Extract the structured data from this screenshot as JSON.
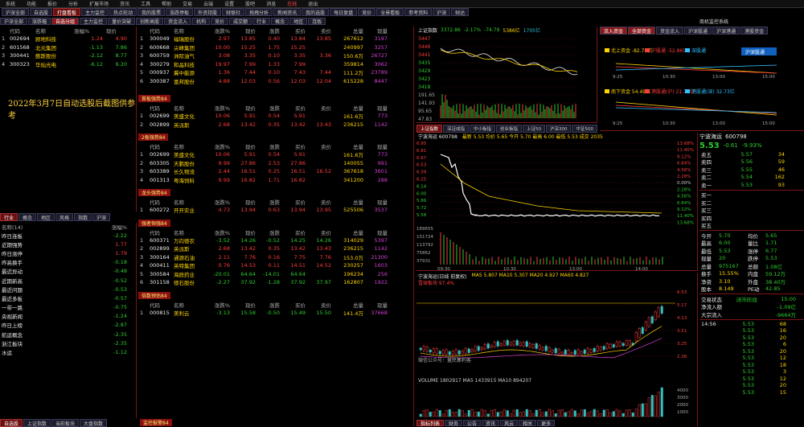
{
  "menu": [
    "系统",
    "功能",
    "报价",
    "分析",
    "扩展市场",
    "资讯",
    "工具",
    "帮助",
    "交易",
    "云端",
    "设置",
    "股吧",
    "消息",
    "在线",
    "退出"
  ],
  "tabs": [
    {
      "label": "沪深全部",
      "active": false
    },
    {
      "label": "自选股",
      "active": false
    },
    {
      "label": "打盘看板",
      "active": true
    },
    {
      "label": "主力监控",
      "active": false
    },
    {
      "label": "热点轮动",
      "active": false
    },
    {
      "label": "我的股票",
      "active": false
    },
    {
      "label": "涨跌停板",
      "active": false
    },
    {
      "label": "外资持股",
      "active": false
    },
    {
      "label": "财联社",
      "active": false
    },
    {
      "label": "拖拽分析",
      "active": false
    },
    {
      "label": "新闻资讯",
      "active": false
    },
    {
      "label": "我的选股",
      "active": false
    },
    {
      "label": "每日复盘",
      "active": false
    },
    {
      "label": "竞价",
      "active": false
    },
    {
      "label": "全景看板",
      "active": false
    },
    {
      "label": "参考资料",
      "active": false
    },
    {
      "label": "沪深",
      "active": false
    },
    {
      "label": "财达",
      "active": false
    }
  ],
  "subtabs": [
    "沪深全部",
    "涨跌幅",
    "自选分组",
    "主力监控",
    "量价突破",
    "创新高股",
    "资金流入",
    "机构",
    "竞价",
    "成交额",
    "行业",
    "概念",
    "地区",
    "连板"
  ],
  "top_right_tab": "商机监控系统",
  "left_table": {
    "headers": [
      "",
      "代码",
      "名称",
      "涨幅%",
      "现价"
    ],
    "rows": [
      [
        "1",
        "002694",
        "顾地科技",
        "1.24",
        "4.90"
      ],
      [
        "2",
        "601568",
        "北元集团",
        "-1.13",
        "7.86"
      ],
      [
        "3",
        "300441",
        "鲍斯股份",
        "-2.12",
        "8.77"
      ],
      [
        "4",
        "300323",
        "华灿光电",
        "-6.12",
        "9.20"
      ]
    ]
  },
  "note": "2022年3月7日自动选股后截图供参考",
  "sector_tabs": [
    "行业",
    "概念",
    "地区",
    "风格",
    "指数",
    "沪深"
  ],
  "sector_table": {
    "headers": [
      "名称(14)",
      "涨幅%"
    ],
    "rows": [
      [
        "昨日连板",
        "-2.22"
      ],
      [
        "近期强势",
        "1.77"
      ],
      [
        "昨日涨停",
        "1.79"
      ],
      [
        "昨高换手",
        "-0.18"
      ],
      [
        "最近异动",
        "-0.48"
      ],
      [
        "近期新高",
        "-0.52"
      ],
      [
        "最近问题",
        "-0.53"
      ],
      [
        "最近多板",
        "-0.57"
      ],
      [
        "一带一路",
        "-0.75"
      ],
      [
        "央视新闻",
        "-1.24"
      ],
      [
        "昨日上榜",
        "-2.87"
      ],
      [
        "航运概念",
        "-2.35"
      ],
      [
        "浙江板块",
        "-2.35"
      ],
      [
        "水运",
        "-1.12"
      ]
    ]
  },
  "bottom_tabs": [
    "自选股",
    "上证指数",
    "当前板块",
    "大盘指数"
  ],
  "mid_headers": [
    "",
    "代码",
    "名称",
    "涨跌%",
    "现价",
    "涨跌",
    "买价",
    "卖价",
    "总量",
    "现量"
  ],
  "mid_groups": [
    {
      "label": "",
      "rows": [
        [
          "1",
          "300049",
          "福瑞股份",
          "2.97",
          "13.85",
          "0.40",
          "13.84",
          "13.85",
          "267612",
          "3197"
        ],
        [
          "2",
          "600668",
          "尖峰集团",
          "10.00",
          "15.25",
          "1.75",
          "15.25",
          "",
          "240997",
          "3257"
        ],
        [
          "3",
          "600759",
          "洲际油气",
          "3.08",
          "3.35",
          "0.10",
          "3.35",
          "3.36",
          "150.6万",
          "26727"
        ],
        [
          "4",
          "300279",
          "和晶科技",
          "19.97",
          "7.99",
          "1.33",
          "7.99",
          "",
          "359814",
          "3062"
        ],
        [
          "5",
          "000937",
          "冀中能源",
          "1.36",
          "7.44",
          "0.10",
          "7.43",
          "7.44",
          "111.2万",
          "23789"
        ],
        [
          "6",
          "300387",
          "富邦股份",
          "4.88",
          "12.03",
          "0.56",
          "12.03",
          "12.04",
          "615228",
          "8447"
        ]
      ]
    },
    {
      "label": "首板强势84",
      "rows": [
        [
          "1",
          "002699",
          "美盛文化",
          "10.06",
          "5.91",
          "0.54",
          "5.91",
          "",
          "161.6万",
          "773"
        ],
        [
          "2",
          "002899",
          "英派斯",
          "2.68",
          "13.42",
          "0.35",
          "13.42",
          "13.43",
          "236215",
          "1142"
        ]
      ]
    },
    {
      "label": "2板强势84",
      "rows": [
        [
          "1",
          "002699",
          "美盛文化",
          "10.06",
          "5.91",
          "0.54",
          "5.91",
          "",
          "161.6万",
          "773"
        ],
        [
          "2",
          "603305",
          "天鹏股份",
          "9.99",
          "27.86",
          "2.53",
          "27.86",
          "",
          "140055",
          "991"
        ],
        [
          "3",
          "603389",
          "长久物流",
          "2.44",
          "16.51",
          "0.25",
          "16.51",
          "16.52",
          "367618",
          "3601"
        ],
        [
          "4",
          "001313",
          "粤海饲料",
          "9.99",
          "16.82",
          "1.71",
          "16.82",
          "",
          "341200",
          "288"
        ]
      ]
    },
    {
      "label": "龙头强势84",
      "rows": [
        [
          "1",
          "600272",
          "开开实业",
          "4.73",
          "13.94",
          "0.63",
          "13.94",
          "13.95",
          "525506",
          "3537"
        ]
      ]
    },
    {
      "label": "强者恒强84",
      "rows": [
        [
          "1",
          "600371",
          "万向德农",
          "-3.52",
          "14.26",
          "-0.52",
          "14.25",
          "14.26",
          "314029",
          "5397"
        ],
        [
          "2",
          "002899",
          "英派斯",
          "2.68",
          "13.42",
          "0.35",
          "13.42",
          "13.43",
          "236215",
          "1142"
        ],
        [
          "3",
          "300164",
          "通源石油",
          "2.11",
          "7.76",
          "0.16",
          "7.75",
          "7.76",
          "153.0万",
          "21300"
        ],
        [
          "4",
          "000411",
          "英特集团",
          "0.76",
          "14.53",
          "0.11",
          "14.51",
          "14.52",
          "230257",
          "1603"
        ],
        [
          "5",
          "300584",
          "海辰药业",
          "-20.01",
          "64.64",
          "-14.01",
          "64.64",
          "",
          "196234",
          "256"
        ],
        [
          "6",
          "301158",
          "德石股份",
          "-2.27",
          "37.92",
          "-1.28",
          "37.92",
          "37.97",
          "162807",
          "1922"
        ]
      ]
    },
    {
      "label": "倍数预估84",
      "rows": [
        [
          "1",
          "000815",
          "美利云",
          "-3.13",
          "15.58",
          "-0.50",
          "15.49",
          "15.50",
          "141.4万",
          "37668"
        ]
      ]
    }
  ],
  "mid_bottom_label": "监控报警84",
  "index_panel": {
    "title": "上证指数",
    "value": "3372.86",
    "chg": "-2.17%",
    "pts": "-74.79",
    "amount": "5386亿",
    "vol": "1705亿",
    "y_labels": [
      "3447",
      "3446",
      "3441",
      "3435",
      "3429",
      "3423",
      "3418",
      "191.65",
      "141.93",
      "95.65",
      "47.83"
    ]
  },
  "index_tabs": [
    "上证指数",
    "深证成指",
    "中小板指",
    "创业板指",
    "上证50",
    "沪深300",
    "中证500"
  ],
  "flow_panel": {
    "tabs": [
      "流入资金",
      "全部资金",
      "资金流入",
      "沪深股通",
      "沪深港通",
      "港股资金"
    ],
    "labels": [
      "北上资金 -82.71亿",
      "沪股通 -52.86亿",
      "深股通",
      "南下资金 54.49亿",
      "港股通(沪) 21.76亿",
      "港股通(深) 32.73亿"
    ],
    "xticks": [
      "9:25",
      "10:30",
      "13:00",
      "15:00"
    ],
    "button": "沪深股通"
  },
  "stock_panel": {
    "name": "宁波海运",
    "code": "600798",
    "price": "5.53",
    "chg": "-0.61",
    "pct": "-9.93%",
    "asks": [
      [
        "卖五",
        "5.57",
        "34"
      ],
      [
        "卖四",
        "5.56",
        "59"
      ],
      [
        "卖三",
        "5.55",
        "46"
      ],
      [
        "卖二",
        "5.54",
        "162"
      ],
      [
        "卖一",
        "5.53",
        "93"
      ]
    ],
    "bids": [
      [
        "买一",
        "",
        ""
      ],
      [
        "买二",
        "",
        ""
      ],
      [
        "买三",
        "",
        ""
      ],
      [
        "买四",
        "",
        ""
      ],
      [
        "买五",
        "",
        ""
      ]
    ],
    "stats": [
      [
        "今开",
        "5.70",
        "均价",
        "5.65"
      ],
      [
        "最高",
        "6.00",
        "量比",
        "1.71"
      ],
      [
        "最低",
        "5.53",
        "涨停",
        "6.77"
      ],
      [
        "现量",
        "20",
        "跌停",
        "5.53"
      ],
      [
        "总量",
        "975167",
        "总额",
        "1.08亿"
      ],
      [
        "换手",
        "15.55%",
        "内盘",
        "59.12万"
      ],
      [
        "净资",
        "3.10",
        "外盘",
        "38.40万"
      ],
      [
        "股本",
        "8.149",
        "PE动",
        "42.85"
      ]
    ],
    "flow": [
      [
        "交易状态",
        "闭市阶段",
        "15:00"
      ],
      [
        "净流入额",
        "",
        "-1.09亿"
      ],
      [
        "大宗流入",
        "",
        "-9664万"
      ]
    ],
    "ticks": [
      [
        "14:56",
        "5.53",
        "68"
      ],
      [
        "",
        "5.53",
        "16"
      ],
      [
        "",
        "5.53",
        "20"
      ],
      [
        "",
        "5.53",
        "6"
      ],
      [
        "",
        "5.53",
        "20"
      ],
      [
        "",
        "5.53",
        "12"
      ],
      [
        "",
        "5.53",
        "18"
      ],
      [
        "",
        "5.53",
        "3"
      ],
      [
        "",
        "5.53",
        "12"
      ],
      [
        "",
        "5.53",
        "20"
      ],
      [
        "",
        "5.53",
        "15"
      ]
    ]
  },
  "intraday": {
    "title": "宁波海运 600798",
    "info": "最新 5.53 均价 5.65 今开 5.70 最高 6.00 最低 5.53 成交 2035",
    "pct_labels": [
      "13.68%",
      "11.40%",
      "9.12%",
      "6.84%",
      "4.56%",
      "2.28%",
      "0.00%",
      "2.28%",
      "4.56%",
      "6.84%",
      "9.12%",
      "11.40%",
      "13.68%"
    ],
    "price_labels": [
      "6.95",
      "6.81",
      "6.67",
      "6.53",
      "6.39",
      "6.25",
      "6.14",
      "6.00",
      "5.86",
      "5.72",
      "5.58"
    ],
    "vol_labels": [
      "189655",
      "151724",
      "113792",
      "75862",
      "37931"
    ],
    "times": [
      "09:30",
      "10:30",
      "13:00",
      "14:00"
    ]
  },
  "kline": {
    "title": "宁波海运(日线 前复权)",
    "subtitle": "雪球板块 97.4%",
    "ma": "MA5 5.807 MA10 5.307 MA20 4.927 MA60 4.827",
    "vol_title": "VOLUME 1802917 MA5 1433915 MA10 894207",
    "watermark": "微信公众号：量民集利客",
    "price_ticks": [
      "6.53",
      "5.17",
      "4.13",
      "3.51",
      "3.25",
      "2.36"
    ],
    "vol_ticks": [
      "4000",
      "3000",
      "2000",
      "1000"
    ]
  },
  "bottom_right_tabs": [
    "指标列表",
    "财务",
    "公告",
    "资讯",
    "风云",
    "相关",
    "更多"
  ],
  "colors": {
    "up": "#ff3c3c",
    "down": "#2ecc2e",
    "border": "#7a1515",
    "accent": "#ffd400"
  }
}
